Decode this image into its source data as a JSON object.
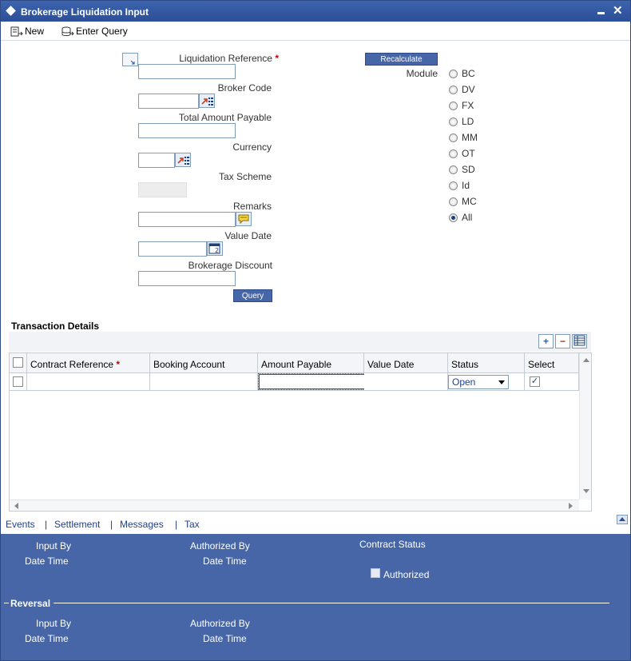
{
  "window": {
    "title": "Brokerage Liquidation Input"
  },
  "toolbar": {
    "new_label": "New",
    "enter_query_label": "Enter Query"
  },
  "form": {
    "liquidation_reference": {
      "label": "Liquidation Reference",
      "required": "*",
      "value": ""
    },
    "broker_code": {
      "label": "Broker Code",
      "value": ""
    },
    "total_amount_payable": {
      "label": "Total Amount Payable",
      "value": ""
    },
    "currency": {
      "label": "Currency",
      "value": ""
    },
    "tax_scheme": {
      "label": "Tax Scheme",
      "value": ""
    },
    "remarks": {
      "label": "Remarks",
      "value": ""
    },
    "value_date": {
      "label": "Value Date",
      "value": ""
    },
    "brokerage_discount": {
      "label": "Brokerage Discount",
      "value": ""
    },
    "query_button": "Query",
    "recalculate_button": "Recalculate",
    "module_label": "Module",
    "modules": [
      "BC",
      "DV",
      "FX",
      "LD",
      "MM",
      "OT",
      "SD",
      "Id",
      "MC",
      "All"
    ],
    "selected_module": "All"
  },
  "transaction_details": {
    "title": "Transaction Details",
    "columns": [
      {
        "label": "Contract Reference",
        "required": "*"
      },
      {
        "label": "Booking Account",
        "required": ""
      },
      {
        "label": "Amount Payable",
        "required": ""
      },
      {
        "label": "Value Date",
        "required": ""
      },
      {
        "label": "Status",
        "required": ""
      },
      {
        "label": "Select",
        "required": ""
      }
    ],
    "rows": [
      {
        "contract_reference": "",
        "booking_account": "",
        "amount_payable": "",
        "value_date": "",
        "status": "Open",
        "select": true
      }
    ]
  },
  "tabs": {
    "events": "Events",
    "settlement": "Settlement",
    "messages": "Messages",
    "tax": "Tax",
    "separator": "|"
  },
  "footer": {
    "input_by": "Input By",
    "date_time": "Date Time",
    "authorized_by": "Authorized By",
    "contract_status": "Contract Status",
    "authorized": "Authorized",
    "reversal": "Reversal"
  }
}
